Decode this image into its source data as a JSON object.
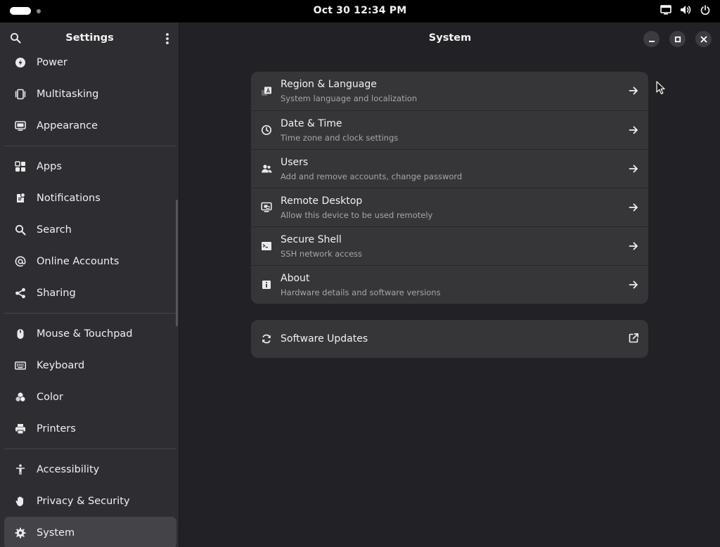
{
  "topbar": {
    "datetime": "Oct 30  12:34 PM",
    "tray_icons": [
      "display-icon",
      "volume-icon",
      "power-icon"
    ]
  },
  "sidebar": {
    "title": "Settings",
    "groups": [
      [
        {
          "label": "Power",
          "icon": "power-settings-icon"
        },
        {
          "label": "Multitasking",
          "icon": "multitasking-icon"
        },
        {
          "label": "Appearance",
          "icon": "appearance-icon"
        }
      ],
      [
        {
          "label": "Apps",
          "icon": "apps-grid-icon"
        },
        {
          "label": "Notifications",
          "icon": "notifications-icon"
        },
        {
          "label": "Search",
          "icon": "search-icon"
        },
        {
          "label": "Online Accounts",
          "icon": "at-sign-icon"
        },
        {
          "label": "Sharing",
          "icon": "share-icon"
        }
      ],
      [
        {
          "label": "Mouse & Touchpad",
          "icon": "mouse-icon"
        },
        {
          "label": "Keyboard",
          "icon": "keyboard-icon"
        },
        {
          "label": "Color",
          "icon": "color-icon"
        },
        {
          "label": "Printers",
          "icon": "printer-icon"
        }
      ],
      [
        {
          "label": "Accessibility",
          "icon": "accessibility-icon"
        },
        {
          "label": "Privacy & Security",
          "icon": "hand-icon"
        },
        {
          "label": "System",
          "icon": "gear-icon",
          "selected": true
        }
      ]
    ]
  },
  "main": {
    "title": "System",
    "rows": [
      {
        "title": "Region & Language",
        "subtitle": "System language and localization",
        "icon": "region-language-icon"
      },
      {
        "title": "Date & Time",
        "subtitle": "Time zone and clock settings",
        "icon": "clock-icon"
      },
      {
        "title": "Users",
        "subtitle": "Add and remove accounts, change password",
        "icon": "users-icon"
      },
      {
        "title": "Remote Desktop",
        "subtitle": "Allow this device to be used remotely",
        "icon": "remote-desktop-icon"
      },
      {
        "title": "Secure Shell",
        "subtitle": "SSH network access",
        "icon": "terminal-icon"
      },
      {
        "title": "About",
        "subtitle": "Hardware details and software versions",
        "icon": "info-icon"
      }
    ],
    "updates": {
      "title": "Software Updates",
      "icon": "refresh-icon",
      "action_icon": "external-link-icon"
    }
  },
  "colors": {
    "window_bg": "#222226",
    "sidebar_bg": "#2e2e32",
    "card_bg": "#363639",
    "selected_bg": "#444448",
    "text": "#f2f2f2",
    "subtext": "#a6a6aa"
  }
}
